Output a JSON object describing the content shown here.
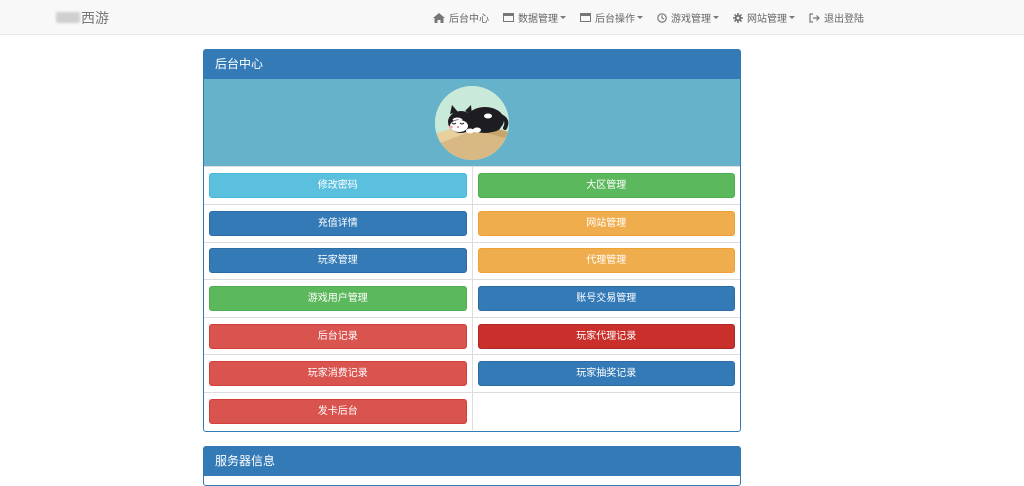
{
  "navbar": {
    "brand": "西游",
    "items": [
      {
        "label": "后台中心",
        "icon": "home-icon",
        "dropdown": false
      },
      {
        "label": "数据管理",
        "icon": "window-icon",
        "dropdown": true
      },
      {
        "label": "后台操作",
        "icon": "window-icon",
        "dropdown": true
      },
      {
        "label": "游戏管理",
        "icon": "clock-icon",
        "dropdown": true
      },
      {
        "label": "网站管理",
        "icon": "gear-icon",
        "dropdown": true
      },
      {
        "label": "退出登陆",
        "icon": "logout-icon",
        "dropdown": false
      }
    ]
  },
  "panel_main": {
    "title": "后台中心",
    "avatar": "cat-avatar-icon",
    "buttons": [
      {
        "label": "修改密码",
        "color": "#5bc0de"
      },
      {
        "label": "大区管理",
        "color": "#5cb85c"
      },
      {
        "label": "充值详情",
        "color": "#337ab7"
      },
      {
        "label": "网站管理",
        "color": "#f0ad4e"
      },
      {
        "label": "玩家管理",
        "color": "#337ab7"
      },
      {
        "label": "代理管理",
        "color": "#f0ad4e"
      },
      {
        "label": "游戏用户管理",
        "color": "#5cb85c"
      },
      {
        "label": "账号交易管理",
        "color": "#337ab7"
      },
      {
        "label": "后台记录",
        "color": "#d9534f"
      },
      {
        "label": "玩家代理记录",
        "color": "#c9302c"
      },
      {
        "label": "玩家消费记录",
        "color": "#d9534f"
      },
      {
        "label": "玩家抽奖记录",
        "color": "#337ab7"
      },
      {
        "label": "发卡后台",
        "color": "#d9534f"
      }
    ]
  },
  "panel_server": {
    "title": "服务器信息"
  }
}
